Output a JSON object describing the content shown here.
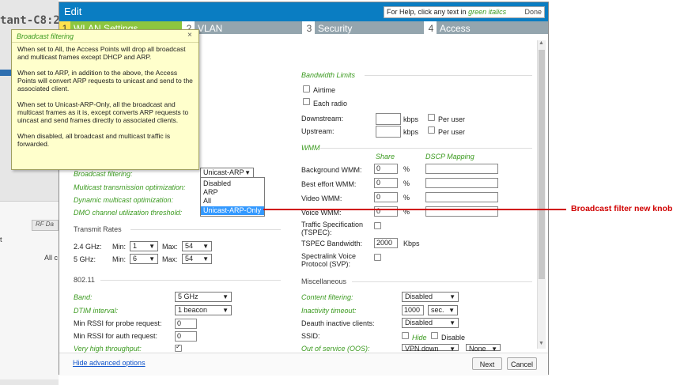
{
  "background": {
    "title": "tant-C8:2",
    "rf_tab": "RF Da",
    "all_col": "All c",
    "left_char": "t"
  },
  "dialog": {
    "title": "Edit",
    "help": {
      "prefix": "For Help, click any text in",
      "green": "green italics",
      "done": "Done"
    },
    "tabs": [
      {
        "num": "1",
        "label": "WLAN Settings"
      },
      {
        "num": "2",
        "label": "VLAN"
      },
      {
        "num": "3",
        "label": "Security"
      },
      {
        "num": "4",
        "label": "Access"
      }
    ],
    "left": {
      "broadcast_filtering": {
        "label": "Broadcast filtering:",
        "value": "Unicast-ARP"
      },
      "multicast_opt": "Multicast transmission optimization:",
      "dynamic_multicast": "Dynamic multicast optimization:",
      "dmo_threshold": "DMO channel utilization threshold:",
      "transmit_rates": "Transmit Rates",
      "rate_24": {
        "label": "2.4 GHz:",
        "min_label": "Min:",
        "min": "1",
        "max_label": "Max:",
        "max": "54"
      },
      "rate_5": {
        "label": "5 GHz:",
        "min_label": "Min:",
        "min": "6",
        "max_label": "Max:",
        "max": "54"
      },
      "dot11": "802.11",
      "band": {
        "label": "Band:",
        "value": "5 GHz"
      },
      "dtim": {
        "label": "DTIM interval:",
        "value": "1 beacon"
      },
      "rssi_probe": {
        "label": "Min RSSI for probe request:",
        "value": "0"
      },
      "rssi_auth": {
        "label": "Min RSSI for auth request:",
        "value": "0"
      },
      "vht": "Very high throughput:"
    },
    "dropdown_options": [
      "Disabled",
      "ARP",
      "All",
      "Unicast-ARP-Only"
    ],
    "right": {
      "bandwidth_limits": "Bandwidth Limits",
      "airtime": "Airtime",
      "each_radio": "Each radio",
      "downstream": {
        "label": "Downstream:",
        "unit": "kbps",
        "per_user": "Per user",
        "value": ""
      },
      "upstream": {
        "label": "Upstream:",
        "unit": "kbps",
        "per_user": "Per user",
        "value": ""
      },
      "wmm": "WMM",
      "share_header": "Share",
      "dscp_header": "DSCP Mapping",
      "wmm_rows": [
        {
          "label": "Background WMM:",
          "value": "0",
          "unit": "%"
        },
        {
          "label": "Best effort WMM:",
          "value": "0",
          "unit": "%"
        },
        {
          "label": "Video WMM:",
          "value": "0",
          "unit": "%"
        },
        {
          "label": "Voice WMM:",
          "value": "0",
          "unit": "%"
        }
      ],
      "tspec": "Traffic Specification (TSPEC):",
      "tspec_bw": {
        "label": "TSPEC Bandwidth:",
        "value": "2000",
        "unit": "Kbps"
      },
      "svp": "Spectralink Voice Protocol (SVP):",
      "misc": "Miscellaneous",
      "content_filtering": {
        "label": "Content filtering:",
        "value": "Disabled"
      },
      "inactivity": {
        "label": "Inactivity timeout:",
        "value": "1000",
        "unit": "sec."
      },
      "deauth": {
        "label": "Deauth inactive clients:",
        "value": "Disabled"
      },
      "ssid": {
        "label": "SSID:",
        "hide": "Hide",
        "disable": "Disable"
      },
      "oos": {
        "label": "Out of service (OOS):",
        "value": "VPN down",
        "value2": "None"
      }
    },
    "footer": {
      "hide_advanced": "Hide advanced options",
      "next": "Next",
      "cancel": "Cancel"
    }
  },
  "tooltip": {
    "title": "Broadcast filtering",
    "close": "×",
    "p1": "When set to All, the Access Points will drop all broadcast and multicast frames except DHCP and ARP.",
    "p2": "When set to ARP, in addition to the above, the Access Points will convert ARP requests to unicast and send to the associated client.",
    "p3": "When set to Unicast-ARP-Only, all the broadcast and multicast frames as it is, except converts ARP requests to uincast and send frames directly to associated clients.",
    "p4": "When disabled, all broadcast and multicast traffic is forwarded."
  },
  "annotation": {
    "text": "Broadcast filter new knob",
    "color": "#d00000"
  },
  "colors": {
    "header": "#0a7dc2",
    "active_tab": "#8dc63f",
    "inactive_tab": "#94a5ae",
    "help_green": "#3b9a1f",
    "dropdown_selected": "#3399ff"
  }
}
